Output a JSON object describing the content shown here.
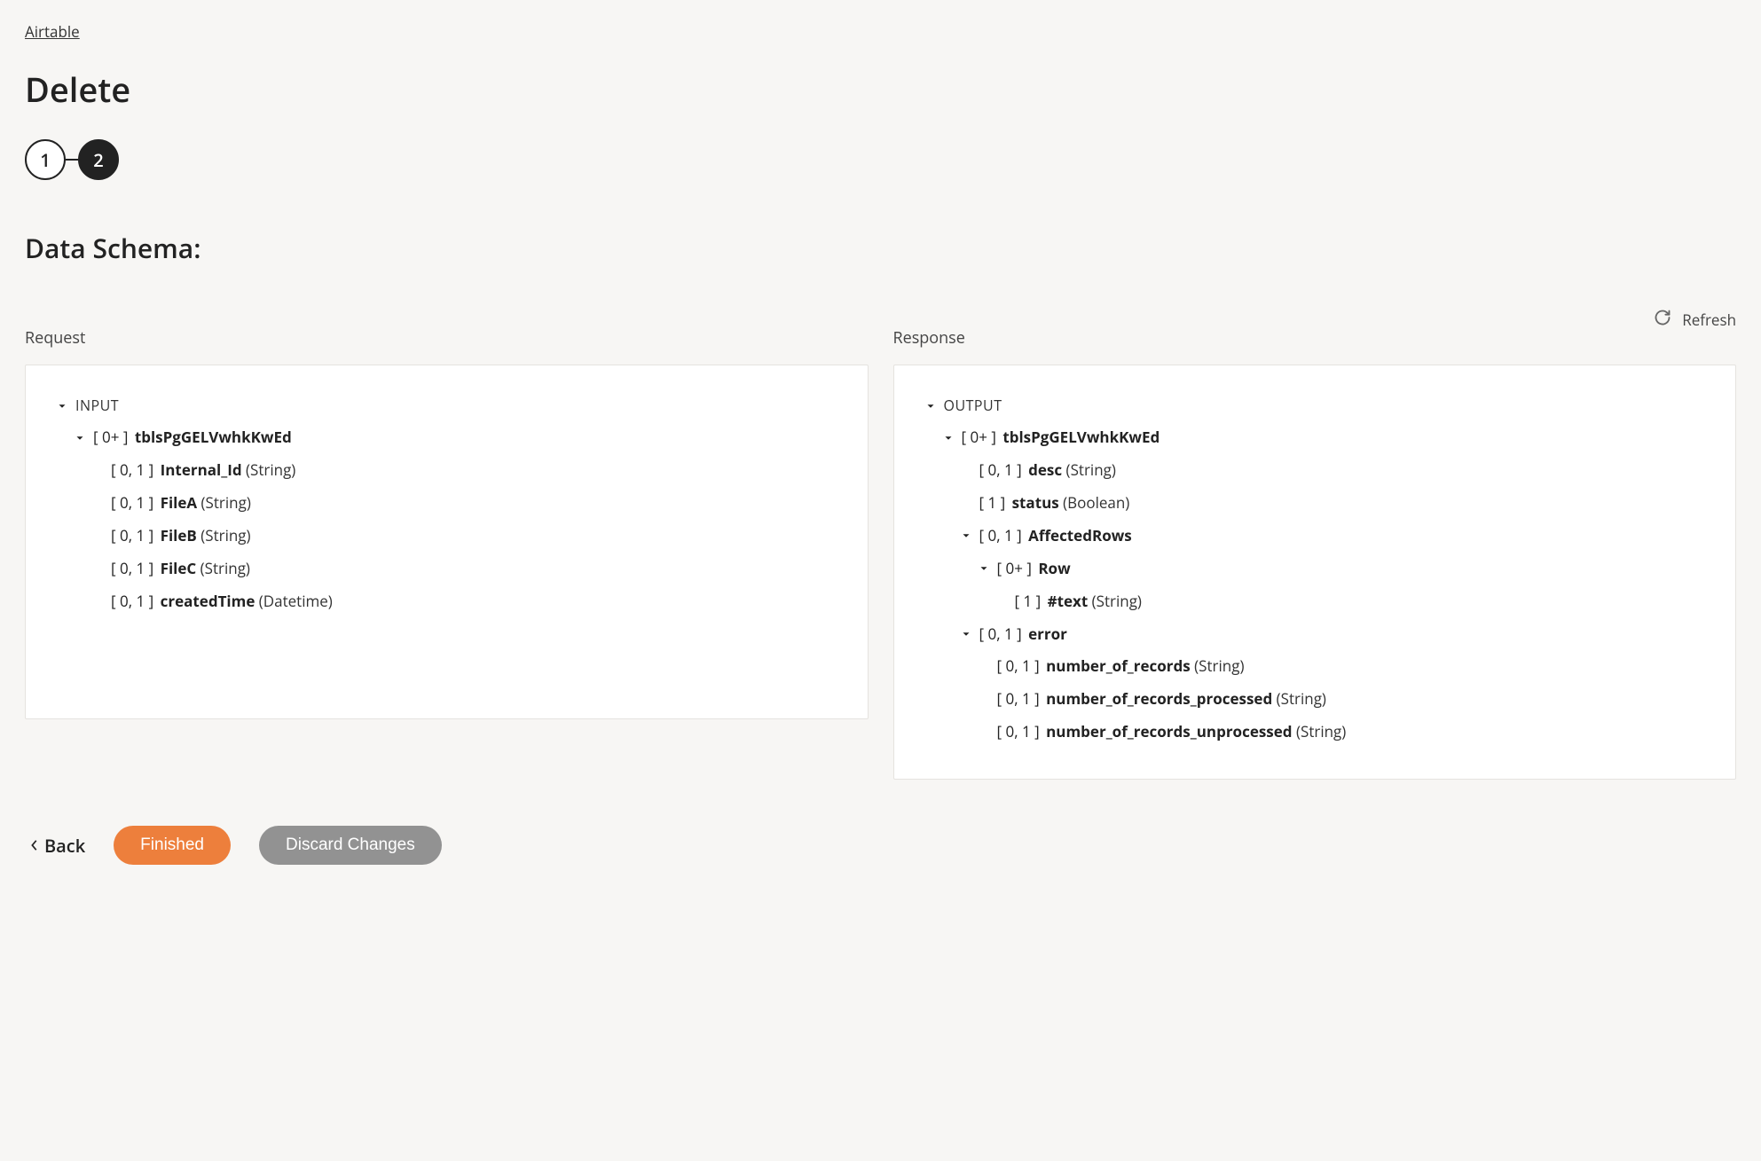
{
  "breadcrumb": "Airtable",
  "page_title": "Delete",
  "stepper": {
    "step1": "1",
    "step2": "2"
  },
  "section_heading": "Data Schema:",
  "refresh_label": "Refresh",
  "labels": {
    "request": "Request",
    "response": "Response"
  },
  "request": {
    "root": "INPUT",
    "items": [
      {
        "indent": 1,
        "chev": true,
        "card": "[ 0+ ]",
        "name": "tblsPgGELVwhkKwEd",
        "type": ""
      },
      {
        "indent": 2,
        "chev": false,
        "card": "[ 0, 1 ]",
        "name": "Internal_Id",
        "type": "(String)"
      },
      {
        "indent": 2,
        "chev": false,
        "card": "[ 0, 1 ]",
        "name": "FileA",
        "type": "(String)"
      },
      {
        "indent": 2,
        "chev": false,
        "card": "[ 0, 1 ]",
        "name": "FileB",
        "type": "(String)"
      },
      {
        "indent": 2,
        "chev": false,
        "card": "[ 0, 1 ]",
        "name": "FileC",
        "type": "(String)"
      },
      {
        "indent": 2,
        "chev": false,
        "card": "[ 0, 1 ]",
        "name": "createdTime",
        "type": "(Datetime)"
      }
    ]
  },
  "response": {
    "root": "OUTPUT",
    "items": [
      {
        "indent": 1,
        "chev": true,
        "card": "[ 0+ ]",
        "name": "tblsPgGELVwhkKwEd",
        "type": ""
      },
      {
        "indent": 2,
        "chev": false,
        "card": "[ 0, 1 ]",
        "name": "desc",
        "type": "(String)"
      },
      {
        "indent": 2,
        "chev": false,
        "card": "[ 1 ]",
        "name": "status",
        "type": "(Boolean)"
      },
      {
        "indent": 2,
        "chev": true,
        "card": "[ 0, 1 ]",
        "name": "AffectedRows",
        "type": ""
      },
      {
        "indent": 3,
        "chev": true,
        "card": "[ 0+ ]",
        "name": "Row",
        "type": ""
      },
      {
        "indent": 4,
        "chev": false,
        "card": "[ 1 ]",
        "name": "#text",
        "type": "(String)"
      },
      {
        "indent": 2,
        "chev": true,
        "card": "[ 0, 1 ]",
        "name": "error",
        "type": ""
      },
      {
        "indent": 3,
        "chev": false,
        "card": "[ 0, 1 ]",
        "name": "number_of_records",
        "type": "(String)"
      },
      {
        "indent": 3,
        "chev": false,
        "card": "[ 0, 1 ]",
        "name": "number_of_records_processed",
        "type": "(String)"
      },
      {
        "indent": 3,
        "chev": false,
        "card": "[ 0, 1 ]",
        "name": "number_of_records_unprocessed",
        "type": "(String)"
      }
    ]
  },
  "footer": {
    "back": "Back",
    "finished": "Finished",
    "discard": "Discard Changes"
  }
}
